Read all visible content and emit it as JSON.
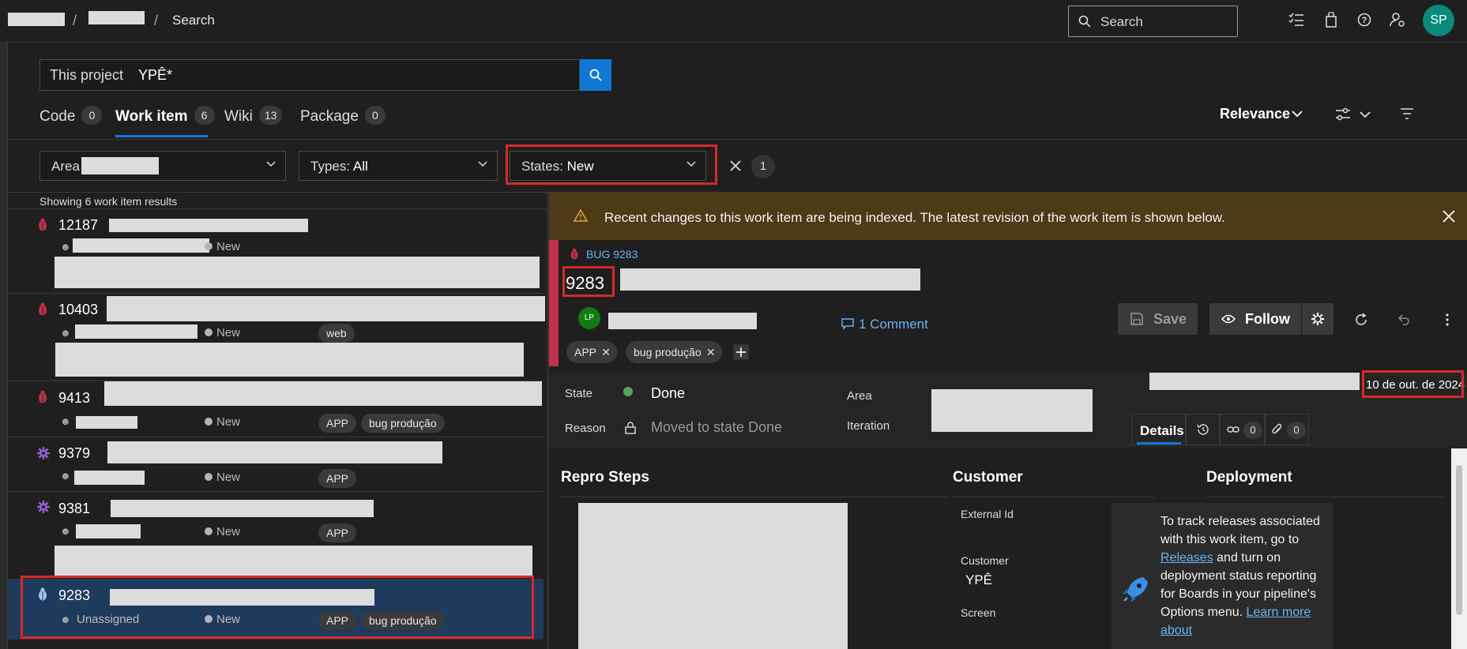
{
  "topbar": {
    "breadcrumb_current": "Search",
    "search_placeholder": "Search",
    "user_initials": "SP",
    "icons": [
      "list-check-icon",
      "shopping-bag-icon",
      "help-icon",
      "user-settings-icon"
    ]
  },
  "query": {
    "scope": "This project",
    "text": "YPÊ*"
  },
  "tabs": [
    {
      "label": "Code",
      "count": "0"
    },
    {
      "label": "Work item",
      "count": "6"
    },
    {
      "label": "Wiki",
      "count": "13"
    },
    {
      "label": "Package",
      "count": "0"
    }
  ],
  "sort": {
    "label": "Relevance"
  },
  "filters": {
    "area_label": "Area",
    "types_label": "Types:",
    "types_value": "All",
    "states_label": "States:",
    "states_value": "New",
    "active_count": "1"
  },
  "results": {
    "summary": "Showing 6 work item results",
    "items": [
      {
        "id": "12187",
        "state": "New",
        "type": "bug",
        "tags": []
      },
      {
        "id": "10403",
        "state": "New",
        "type": "bug",
        "tags": [
          "web"
        ]
      },
      {
        "id": "9413",
        "state": "New",
        "type": "bug",
        "tags": [
          "APP",
          "bug produção"
        ]
      },
      {
        "id": "9379",
        "state": "New",
        "type": "feature",
        "tags": [
          "APP"
        ]
      },
      {
        "id": "9381",
        "state": "New",
        "type": "feature",
        "tags": [
          "APP"
        ]
      },
      {
        "id": "9283",
        "state": "New",
        "type": "bug",
        "assignee": "Unassigned",
        "tags": [
          "APP",
          "bug produção"
        ]
      }
    ]
  },
  "detail": {
    "banner": "Recent changes to this work item are being indexed. The latest revision of the work item is shown below.",
    "type_label": "BUG 9283",
    "id": "9283",
    "assignee_initials": "LP",
    "comment_link": "1 Comment",
    "save_label": "Save",
    "follow_label": "Follow",
    "tags": [
      "APP",
      "bug produção"
    ],
    "fields": {
      "state_label": "State",
      "state_value": "Done",
      "reason_label": "Reason",
      "reason_value": "Moved to state Done",
      "area_label": "Area",
      "iteration_label": "Iteration",
      "date_value": "10 de out. de 2024"
    },
    "detail_tabs": {
      "details_label": "Details",
      "links_count": "0",
      "attachments_count": "0"
    },
    "sections": {
      "repro_title": "Repro Steps",
      "customer_title": "Customer",
      "deployment_title": "Deployment",
      "external_id_label": "External Id",
      "customer_label": "Customer",
      "customer_value": "YPÊ",
      "screen_label": "Screen",
      "deploy_text_1": "To track releases associated with this work item, go to ",
      "deploy_link_1": "Releases",
      "deploy_text_2": " and turn on deployment status reporting for Boards in your pipeline's Options menu. ",
      "deploy_link_2": "Learn more about"
    }
  },
  "colors": {
    "accent": "#0f78d4",
    "bug_red": "#c4314b",
    "done_green": "#55a362",
    "banner_bg": "#4d3a17",
    "selected_row": "#1e3a5c"
  }
}
